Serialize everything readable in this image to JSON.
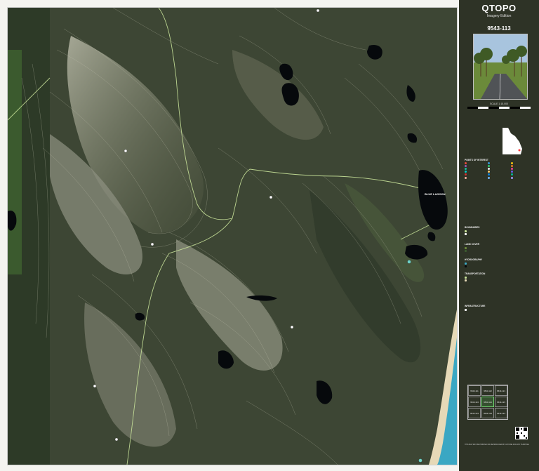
{
  "map": {
    "lake_label": "BLUE LAGOON"
  },
  "legend": {
    "title": "QTOPO",
    "subtitle": "Imagery Edition",
    "sheet_number": "9543-113",
    "scale": "SCALE 1:15,000",
    "sections": {
      "points_of_interest": "POINTS OF INTEREST",
      "boundaries": "BOUNDARIES",
      "land_cover": "LAND COVER",
      "hydrography": "HYDROGRAPHY",
      "transportation": "TRANSPORTATION",
      "infrastructure": "INFRASTRUCTURE"
    },
    "colors": {
      "panel": "#2e3326",
      "map_dark": "#3d4634",
      "track": "#c9e39a",
      "water": "#06090c",
      "ocean": "#3aa7c3",
      "sand": "#e6d9b7"
    },
    "index_sheets": [
      "9543-111",
      "9543-112",
      "9543-121",
      "9543-113",
      "9543-114",
      "9543-123",
      "9543-133",
      "9543-134",
      "9543-143"
    ],
    "footer_notice": "THIS MAP MAY BE PRINTED OR REPRODUCED BY ANYONE FOR ANY PURPOSE"
  }
}
